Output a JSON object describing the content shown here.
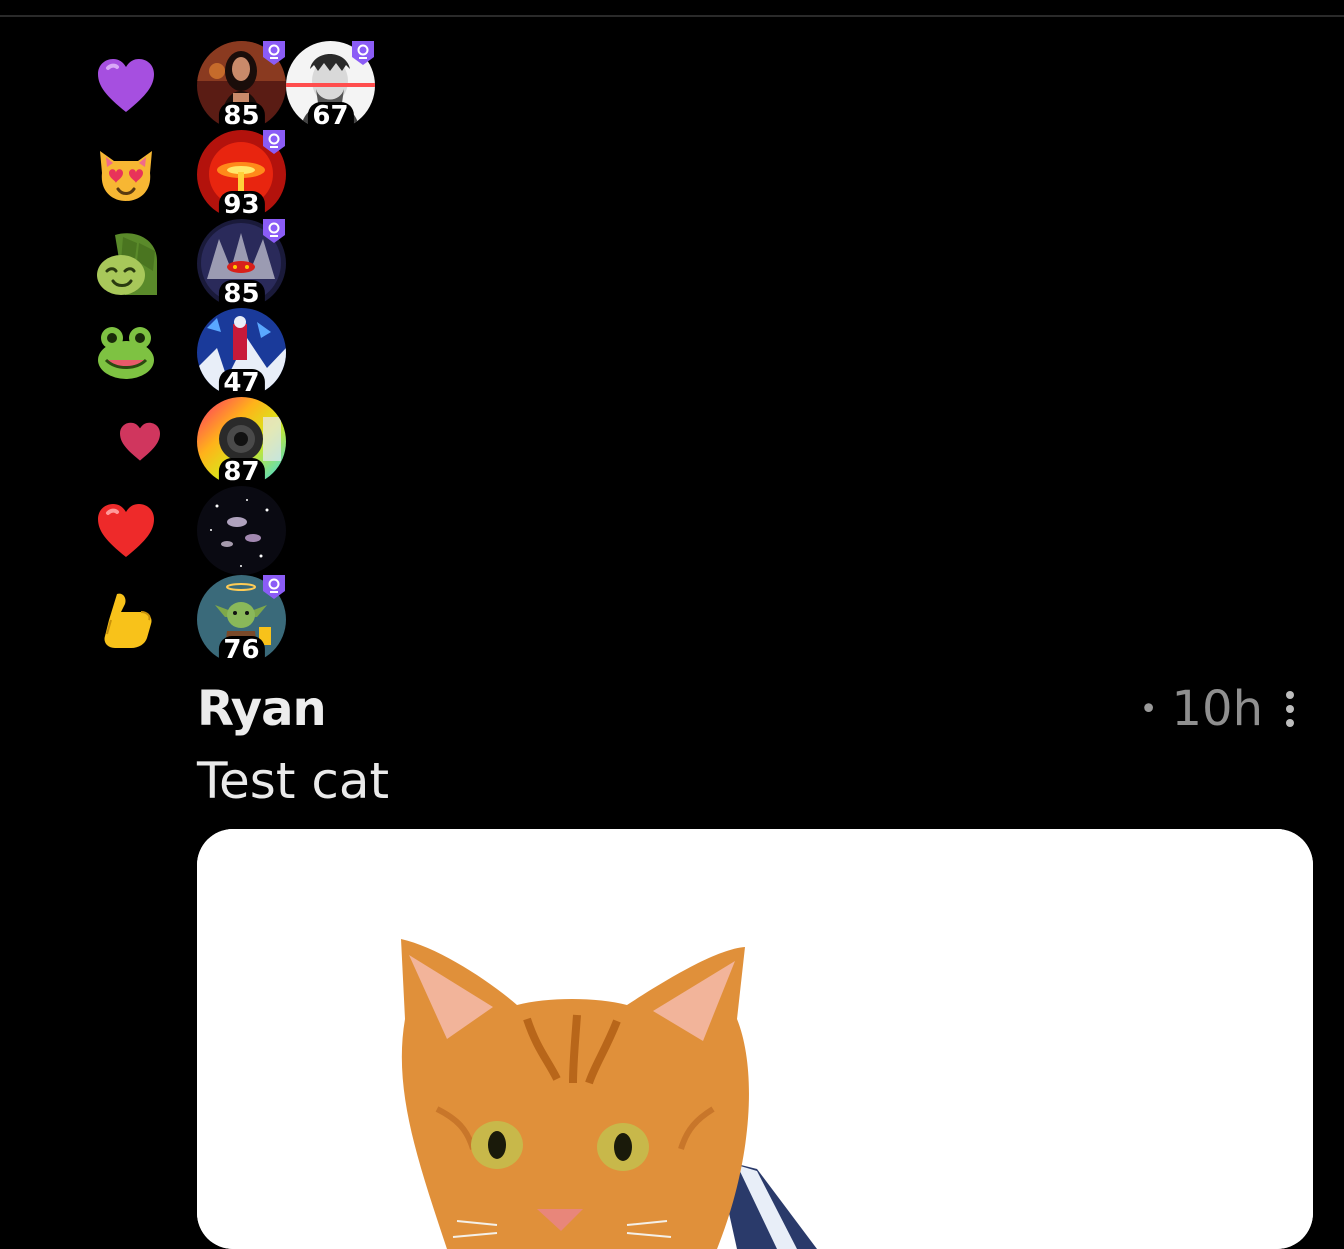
{
  "reactions": [
    {
      "emoji": "💜",
      "emoji_name": "purple-heart",
      "users": [
        {
          "score": "85",
          "verified": true,
          "avatar": "woman-dark-hair"
        },
        {
          "score": "67",
          "verified": true,
          "avatar": "masked-man-laser-eyes"
        }
      ]
    },
    {
      "emoji": "😻",
      "emoji_name": "heart-eyes-cat",
      "users": [
        {
          "score": "93",
          "verified": true,
          "avatar": "red-explosion"
        }
      ]
    },
    {
      "emoji": "🐢",
      "emoji_name": "turtle",
      "users": [
        {
          "score": "85",
          "verified": true,
          "avatar": "dark-spider"
        }
      ]
    },
    {
      "emoji": "🐸",
      "emoji_name": "frog",
      "users": [
        {
          "score": "47",
          "verified": false,
          "avatar": "blue-comic-art"
        }
      ]
    },
    {
      "emoji": "❤",
      "emoji_name": "small-heart",
      "users": [
        {
          "score": "87",
          "verified": false,
          "avatar": "rainbow-lens"
        }
      ]
    },
    {
      "emoji": "❤️",
      "emoji_name": "red-heart",
      "users": [
        {
          "score": "",
          "verified": false,
          "avatar": "galaxy"
        }
      ]
    },
    {
      "emoji": "🤙",
      "emoji_name": "call-me-hand",
      "users": [
        {
          "score": "76",
          "verified": true,
          "avatar": "yoda-beer"
        }
      ]
    }
  ],
  "post": {
    "author": "Ryan",
    "separator": "•",
    "time": "10h",
    "text": "Test cat",
    "image": "orange-tabby-cat"
  },
  "colors": {
    "background": "#000000",
    "badge": "#8b5cf6",
    "card": "#ffffff"
  }
}
